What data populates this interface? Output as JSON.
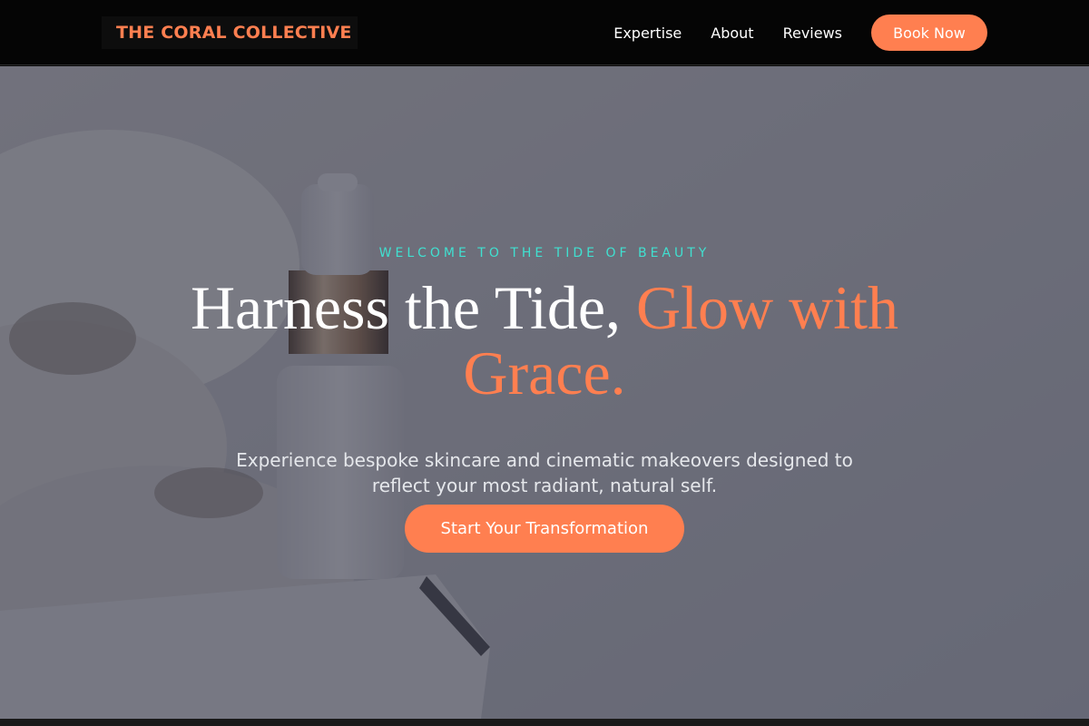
{
  "brand": {
    "name": "THE CORAL COLLECTIVE",
    "accent_color": "#ff7f50",
    "teal_color": "#40e0d0"
  },
  "nav": {
    "links": [
      "Expertise",
      "About",
      "Reviews"
    ],
    "cta_label": "Book Now"
  },
  "hero": {
    "eyebrow": "WELCOME TO THE TIDE OF BEAUTY",
    "headline_main": "Harness the Tide, ",
    "headline_accent": "Glow with Grace.",
    "subtext": "Experience bespoke skincare and cinematic makeovers designed to reflect your most radiant, natural self.",
    "cta_label": "Start Your Transformation"
  }
}
